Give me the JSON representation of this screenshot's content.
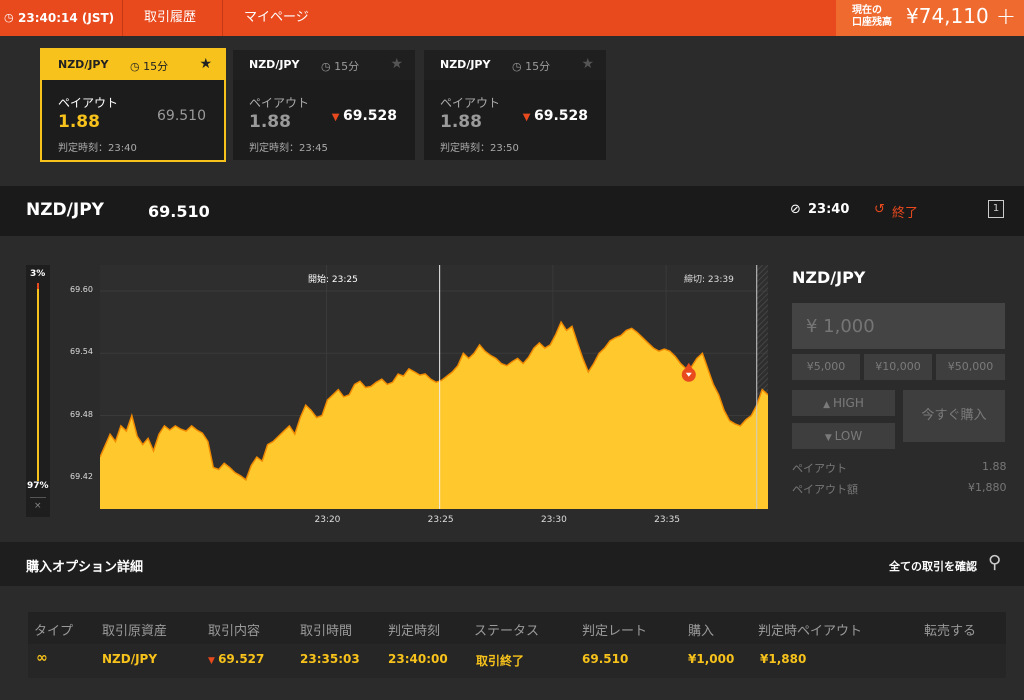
{
  "topbar": {
    "time": "23:40:14 (JST)",
    "history": "取引履歴",
    "mypage": "マイページ",
    "balance_label_line1": "現在の",
    "balance_label_line2": "口座残高",
    "balance": "¥74,110",
    "add": "+"
  },
  "cards": [
    {
      "pair": "NZD/JPY",
      "duration": "15分",
      "payout_label": "ペイアウト",
      "payout": "1.88",
      "rate": "69.510",
      "rate_dir": "",
      "decision": "判定時刻：23:40",
      "active": true
    },
    {
      "pair": "NZD/JPY",
      "duration": "15分",
      "payout_label": "ペイアウト",
      "payout": "1.88",
      "rate": "69.528",
      "rate_dir": "down",
      "decision": "判定時刻：23:45",
      "active": false
    },
    {
      "pair": "NZD/JPY",
      "duration": "15分",
      "payout_label": "ペイアウト",
      "payout": "1.88",
      "rate": "69.528",
      "rate_dir": "down",
      "decision": "判定時刻：23:50",
      "active": false
    }
  ],
  "pairbar": {
    "pair": "NZD/JPY",
    "rate": "69.510",
    "time": "23:40",
    "status": "終了"
  },
  "gauge": {
    "top": "3%",
    "bottom": "97%",
    "close": "×",
    "top_fraction": 0.03
  },
  "chart_data": {
    "type": "area",
    "ylim": [
      69.39,
      69.625
    ],
    "xlim": [
      23.1666,
      23.6583
    ],
    "x_ticks": [
      "23:20",
      "23:25",
      "23:30",
      "23:35"
    ],
    "x_tick_values": [
      23.3333,
      23.4166,
      23.5,
      23.5833
    ],
    "y_ticks": [
      "69.60",
      "69.54",
      "69.48",
      "69.42"
    ],
    "y_tick_values": [
      69.6,
      69.54,
      69.48,
      69.42
    ],
    "start_label": "開始: 23:25",
    "start_value": 23.4166,
    "end_label": "締切: 23:39",
    "end_value": 23.65,
    "entry_value": 69.527,
    "entry_x": 23.6,
    "series": [
      {
        "values": [
          [
            23.1666,
            69.44
          ],
          [
            23.17,
            69.45
          ],
          [
            23.174,
            69.462
          ],
          [
            23.178,
            69.455
          ],
          [
            23.182,
            69.47
          ],
          [
            23.186,
            69.465
          ],
          [
            23.19,
            69.48
          ],
          [
            23.194,
            69.46
          ],
          [
            23.198,
            69.452
          ],
          [
            23.202,
            69.458
          ],
          [
            23.206,
            69.446
          ],
          [
            23.21,
            69.462
          ],
          [
            23.214,
            69.47
          ],
          [
            23.218,
            69.466
          ],
          [
            23.222,
            69.47
          ],
          [
            23.226,
            69.467
          ],
          [
            23.23,
            69.465
          ],
          [
            23.234,
            69.47
          ],
          [
            23.238,
            69.466
          ],
          [
            23.242,
            69.463
          ],
          [
            23.246,
            69.455
          ],
          [
            23.25,
            69.43
          ],
          [
            23.254,
            69.428
          ],
          [
            23.258,
            69.434
          ],
          [
            23.262,
            69.43
          ],
          [
            23.266,
            69.425
          ],
          [
            23.27,
            69.422
          ],
          [
            23.274,
            69.418
          ],
          [
            23.278,
            69.432
          ],
          [
            23.282,
            69.44
          ],
          [
            23.286,
            69.436
          ],
          [
            23.29,
            69.452
          ],
          [
            23.294,
            69.455
          ],
          [
            23.298,
            69.46
          ],
          [
            23.302,
            69.465
          ],
          [
            23.306,
            69.47
          ],
          [
            23.31,
            69.462
          ],
          [
            23.314,
            69.478
          ],
          [
            23.318,
            69.49
          ],
          [
            23.322,
            69.485
          ],
          [
            23.326,
            69.478
          ],
          [
            23.33,
            69.48
          ],
          [
            23.334,
            69.495
          ],
          [
            23.338,
            69.5
          ],
          [
            23.342,
            69.505
          ],
          [
            23.346,
            69.498
          ],
          [
            23.35,
            69.5
          ],
          [
            23.354,
            69.51
          ],
          [
            23.358,
            69.513
          ],
          [
            23.362,
            69.507
          ],
          [
            23.366,
            69.508
          ],
          [
            23.37,
            69.512
          ],
          [
            23.374,
            69.515
          ],
          [
            23.378,
            69.51
          ],
          [
            23.382,
            69.512
          ],
          [
            23.386,
            69.52
          ],
          [
            23.39,
            69.518
          ],
          [
            23.394,
            69.525
          ],
          [
            23.398,
            69.522
          ],
          [
            23.402,
            69.519
          ],
          [
            23.406,
            69.52
          ],
          [
            23.41,
            69.515
          ],
          [
            23.414,
            69.512
          ],
          [
            23.418,
            69.514
          ],
          [
            23.422,
            69.518
          ],
          [
            23.426,
            69.522
          ],
          [
            23.43,
            69.528
          ],
          [
            23.434,
            69.54
          ],
          [
            23.438,
            69.535
          ],
          [
            23.442,
            69.54
          ],
          [
            23.446,
            69.548
          ],
          [
            23.45,
            69.542
          ],
          [
            23.454,
            69.538
          ],
          [
            23.458,
            69.535
          ],
          [
            23.462,
            69.53
          ],
          [
            23.466,
            69.528
          ],
          [
            23.47,
            69.532
          ],
          [
            23.474,
            69.535
          ],
          [
            23.478,
            69.53
          ],
          [
            23.482,
            69.536
          ],
          [
            23.486,
            69.545
          ],
          [
            23.49,
            69.55
          ],
          [
            23.494,
            69.545
          ],
          [
            23.498,
            69.548
          ],
          [
            23.502,
            69.558
          ],
          [
            23.506,
            69.57
          ],
          [
            23.51,
            69.562
          ],
          [
            23.514,
            69.566
          ],
          [
            23.518,
            69.55
          ],
          [
            23.522,
            69.535
          ],
          [
            23.526,
            69.522
          ],
          [
            23.53,
            69.53
          ],
          [
            23.534,
            69.54
          ],
          [
            23.538,
            69.545
          ],
          [
            23.542,
            69.552
          ],
          [
            23.546,
            69.555
          ],
          [
            23.55,
            69.557
          ],
          [
            23.554,
            69.562
          ],
          [
            23.558,
            69.564
          ],
          [
            23.562,
            69.56
          ],
          [
            23.566,
            69.555
          ],
          [
            23.57,
            69.55
          ],
          [
            23.574,
            69.545
          ],
          [
            23.578,
            69.542
          ],
          [
            23.582,
            69.544
          ],
          [
            23.586,
            69.542
          ],
          [
            23.59,
            69.537
          ],
          [
            23.594,
            69.53
          ],
          [
            23.598,
            69.525
          ],
          [
            23.602,
            69.527
          ],
          [
            23.606,
            69.535
          ],
          [
            23.61,
            69.54
          ],
          [
            23.614,
            69.525
          ],
          [
            23.618,
            69.51
          ],
          [
            23.622,
            69.5
          ],
          [
            23.626,
            69.485
          ],
          [
            23.63,
            69.475
          ],
          [
            23.634,
            69.472
          ],
          [
            23.638,
            69.47
          ],
          [
            23.642,
            69.476
          ],
          [
            23.646,
            69.48
          ],
          [
            23.65,
            69.49
          ],
          [
            23.654,
            69.505
          ],
          [
            23.6583,
            69.5
          ]
        ]
      }
    ]
  },
  "right_panel": {
    "pair": "NZD/JPY",
    "amount_placeholder": "¥ 1,000",
    "presets": [
      "¥5,000",
      "¥10,000",
      "¥50,000"
    ],
    "high": "HIGH",
    "low": "LOW",
    "buy_now": "今すぐ購入",
    "payout_label": "ペイアウト",
    "payout_value": "1.88",
    "payout_amount_label": "ペイアウト額",
    "payout_amount_value": "¥1,880"
  },
  "detail": {
    "title": "購入オプション詳細",
    "view_all": "全ての取引を確認"
  },
  "table": {
    "headers": [
      "タイプ",
      "取引原資産",
      "取引内容",
      "取引時間",
      "判定時刻",
      "ステータス",
      "判定レート",
      "購入",
      "判定時ペイアウト",
      "転売する"
    ],
    "row": {
      "asset": "NZD/JPY",
      "content": "69.527",
      "trade_time": "23:35:03",
      "decision_time": "23:40:00",
      "status": "取引終了",
      "decision_rate": "69.510",
      "purchase": "¥1,000",
      "payout": "¥1,880"
    }
  },
  "colors": {
    "accent": "#e8491d",
    "gold": "#f7c21b",
    "chart_fill": "#ffc92e",
    "chart_line": "#f08a00",
    "down": "#e8491d"
  }
}
